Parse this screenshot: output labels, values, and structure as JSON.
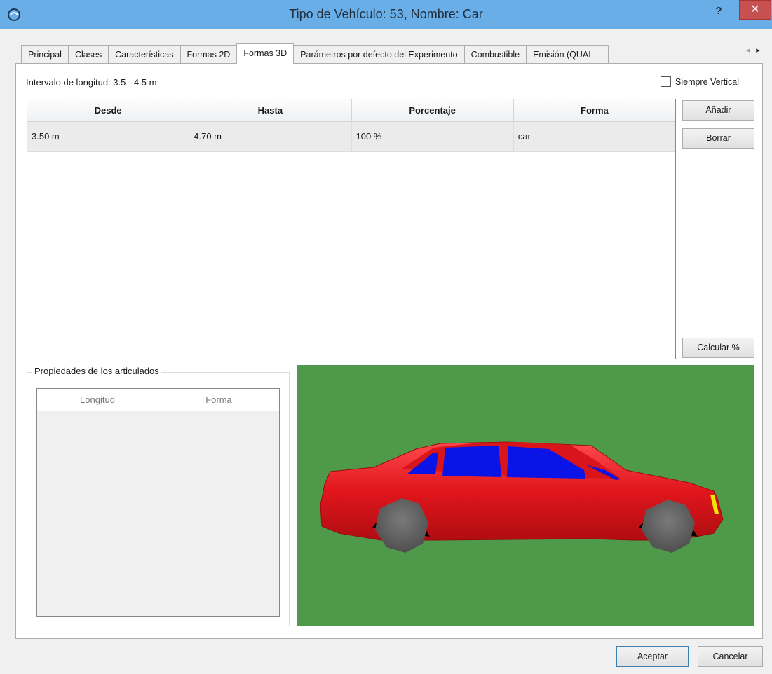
{
  "window": {
    "title": "Tipo de Vehículo: 53, Nombre: Car",
    "help": "?",
    "close": "✕"
  },
  "tabs": [
    {
      "label": "Principal"
    },
    {
      "label": "Clases"
    },
    {
      "label": "Características"
    },
    {
      "label": "Formas 2D"
    },
    {
      "label": "Formas 3D"
    },
    {
      "label": "Parámetros por defecto del Experimento"
    },
    {
      "label": "Combustible"
    },
    {
      "label": "Emisión (QUAI"
    }
  ],
  "active_tab": "Formas 3D",
  "panel": {
    "interval_label": "Intervalo de longitud: 3.5 - 4.5 m",
    "always_vertical_label": "Siempre Vertical",
    "always_vertical_checked": false,
    "table": {
      "columns": [
        "Desde",
        "Hasta",
        "Porcentaje",
        "Forma"
      ],
      "rows": [
        [
          "3.50 m",
          "4.70 m",
          "100 %",
          "car"
        ]
      ]
    },
    "buttons": {
      "add": "Añadir",
      "delete": "Borrar",
      "calculate": "Calcular %"
    },
    "articulated": {
      "title": "Propiedades de los articulados",
      "columns": [
        "Longitud",
        "Forma"
      ]
    }
  },
  "footer": {
    "accept": "Aceptar",
    "cancel": "Cancelar"
  },
  "colors": {
    "titlebar": "#6aaee8",
    "viewport_bg": "#4e9a4a",
    "car_body": "#e0161c",
    "car_windows": "#0a14e6"
  }
}
